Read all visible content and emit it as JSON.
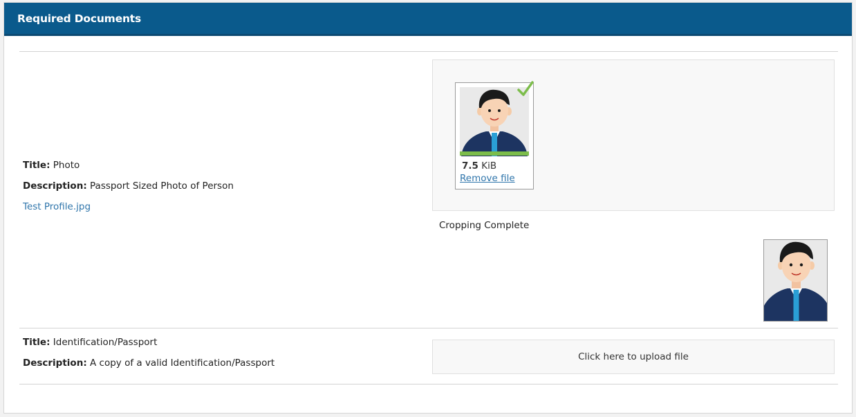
{
  "header": {
    "title": "Required Documents"
  },
  "documents": [
    {
      "title_label": "Title:",
      "title": "Photo",
      "description_label": "Description:",
      "description": "Passport Sized Photo of Person",
      "file_link": "Test Profile.jpg",
      "preview": {
        "size_value": "7.5",
        "size_unit": "KiB",
        "remove_label": "Remove file",
        "upload_progress": 1.0,
        "status_icon": "check-icon"
      },
      "crop_status": "Cropping Complete"
    },
    {
      "title_label": "Title:",
      "title": "Identification/Passport",
      "description_label": "Description:",
      "description": "A copy of a valid Identification/Passport",
      "upload_label": "Click here to upload file"
    }
  ],
  "colors": {
    "header_bg": "#0a5a8c",
    "link": "#2f75ab",
    "success": "#7cbd4a",
    "shirt": "#1d3461",
    "tie": "#2a9fd6"
  }
}
